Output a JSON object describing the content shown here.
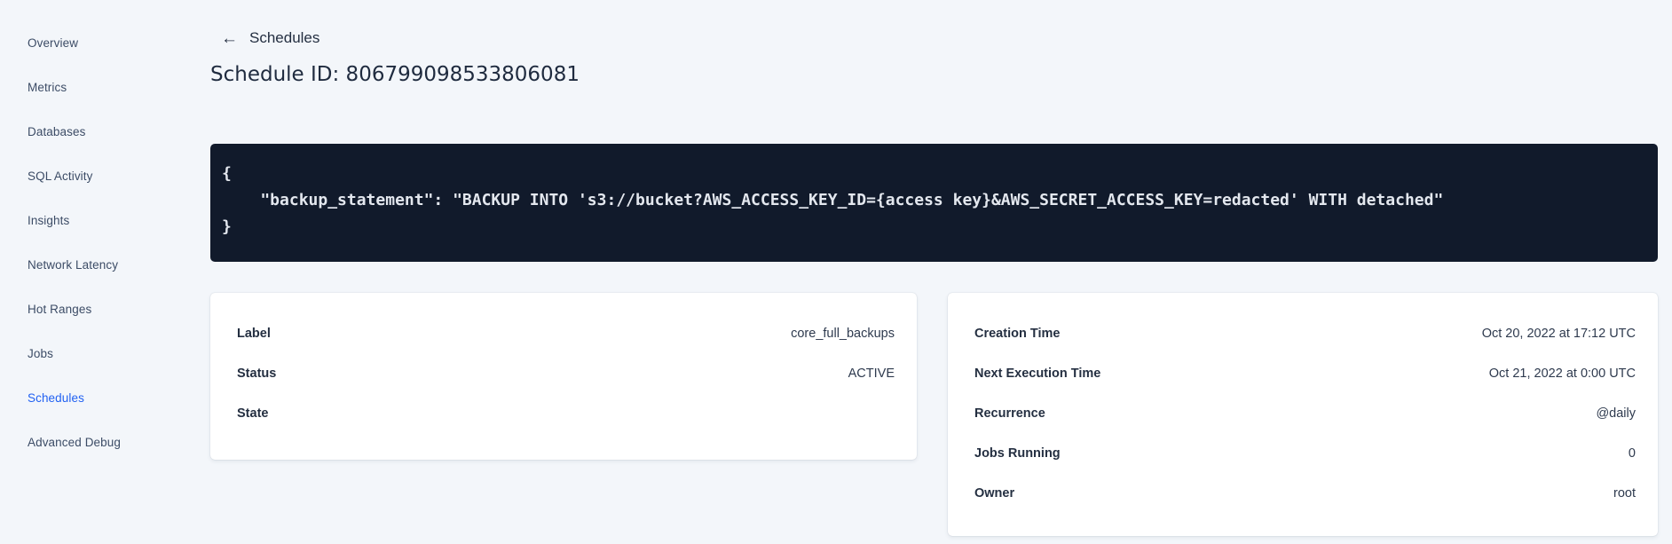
{
  "sidebar": {
    "items": [
      {
        "label": "Overview"
      },
      {
        "label": "Metrics"
      },
      {
        "label": "Databases"
      },
      {
        "label": "SQL Activity"
      },
      {
        "label": "Insights"
      },
      {
        "label": "Network Latency"
      },
      {
        "label": "Hot Ranges"
      },
      {
        "label": "Jobs"
      },
      {
        "label": "Schedules"
      },
      {
        "label": "Advanced Debug"
      }
    ],
    "active_item": "Schedules",
    "active_color": "#2161f2"
  },
  "header": {
    "back_icon": "←",
    "back_label": "Schedules",
    "title": "Schedule ID: 806799098533806081"
  },
  "code_block": {
    "background": "#111a2b",
    "lines": [
      "{",
      "    \"backup_statement\": \"BACKUP INTO 's3://bucket?AWS_ACCESS_KEY_ID={access key}&AWS_SECRET_ACCESS_KEY=redacted' WITH detached\"",
      "}"
    ]
  },
  "details_card": {
    "rows": [
      {
        "label": "Label",
        "value": "core_full_backups"
      },
      {
        "label": "Status",
        "value": "ACTIVE"
      },
      {
        "label": "State",
        "value": ""
      }
    ]
  },
  "schedule_card": {
    "rows": [
      {
        "label": "Creation Time",
        "value": "Oct 20, 2022 at 17:12 UTC"
      },
      {
        "label": "Next Execution Time",
        "value": "Oct 21, 2022 at 0:00 UTC"
      },
      {
        "label": "Recurrence",
        "value": "@daily"
      },
      {
        "label": "Jobs Running",
        "value": "0"
      },
      {
        "label": "Owner",
        "value": "root"
      }
    ]
  }
}
